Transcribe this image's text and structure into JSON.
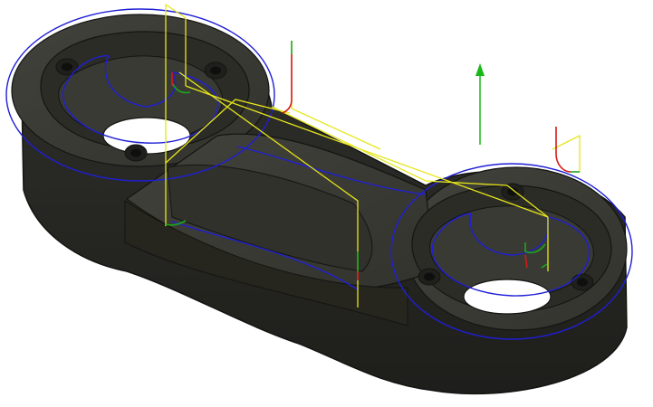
{
  "viewport": {
    "name": "cam-toolpath-preview",
    "part": "machined-linkage-part",
    "colors": {
      "background": "#ffffff",
      "part_top": "#3b3b36",
      "part_side": "#2b2b27",
      "part_edge": "#141412",
      "pocket_floor": "#34342f",
      "hole": "#ffffff",
      "contour_path": "#1f1fd6",
      "rapid_move": "#e6e61a",
      "lead_in": "#1aa81a",
      "plunge": "#d41a1a",
      "tool_axis": "#18b818"
    }
  }
}
